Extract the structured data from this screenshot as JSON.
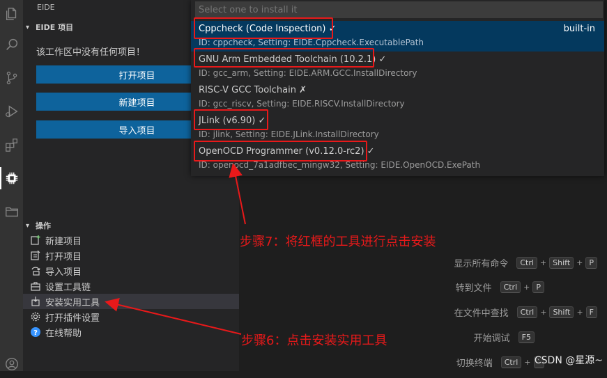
{
  "sidebar": {
    "title": "EIDE",
    "project_section": "EIDE 项目",
    "empty_message": "该工作区中没有任何项目！",
    "buttons": [
      "打开项目",
      "新建项目",
      "导入项目"
    ],
    "ops_section": "操作",
    "ops": [
      {
        "label": "新建项目",
        "icon": "new-project-icon"
      },
      {
        "label": "打开项目",
        "icon": "open-project-icon"
      },
      {
        "label": "导入项目",
        "icon": "import-project-icon"
      },
      {
        "label": "设置工具链",
        "icon": "toolchain-icon"
      },
      {
        "label": "安装实用工具",
        "icon": "install-tools-icon"
      },
      {
        "label": "打开插件设置",
        "icon": "settings-gear-icon"
      },
      {
        "label": "在线帮助",
        "icon": "help-icon"
      }
    ]
  },
  "quickpick": {
    "placeholder": "Select one to install it",
    "items": [
      {
        "label": "Cppcheck (Code Inspection) ✓",
        "detail": "ID: cppcheck, Setting: EIDE.Cppcheck.ExecutablePath",
        "description": "built-in"
      },
      {
        "label": "GNU Arm Embedded Toolchain (10.2.1) ✓",
        "detail": "ID: gcc_arm, Setting: EIDE.ARM.GCC.InstallDirectory",
        "description": ""
      },
      {
        "label": "RISC-V GCC Toolchain ✗",
        "detail": "ID: gcc_riscv, Setting: EIDE.RISCV.InstallDirectory",
        "description": ""
      },
      {
        "label": "JLink (v6.90) ✓",
        "detail": "ID: jlink, Setting: EIDE.JLink.InstallDirectory",
        "description": ""
      },
      {
        "label": "OpenOCD Programmer (v0.12.0-rc2) ✓",
        "detail": "ID: openocd_7a1adfbec_mingw32, Setting: EIDE.OpenOCD.ExePath",
        "description": ""
      }
    ]
  },
  "shortcuts": [
    {
      "label": "显示所有命令",
      "keys": [
        "Ctrl",
        "Shift",
        "P"
      ]
    },
    {
      "label": "转到文件",
      "keys": [
        "Ctrl",
        "P"
      ]
    },
    {
      "label": "在文件中查找",
      "keys": [
        "Ctrl",
        "Shift",
        "F"
      ]
    },
    {
      "label": "开始调试",
      "keys": [
        "F5"
      ]
    },
    {
      "label": "切换终端",
      "keys": [
        "Ctrl",
        "`"
      ]
    }
  ],
  "annotations": {
    "step7": "步骤7：将红框的工具进行点击安装",
    "step6": "步骤6：点击安装实用工具"
  },
  "watermark": "CSDN @星源~",
  "colors": {
    "accent": "#0e639c",
    "selection": "#04395e",
    "annotation_red": "#e8191a"
  }
}
